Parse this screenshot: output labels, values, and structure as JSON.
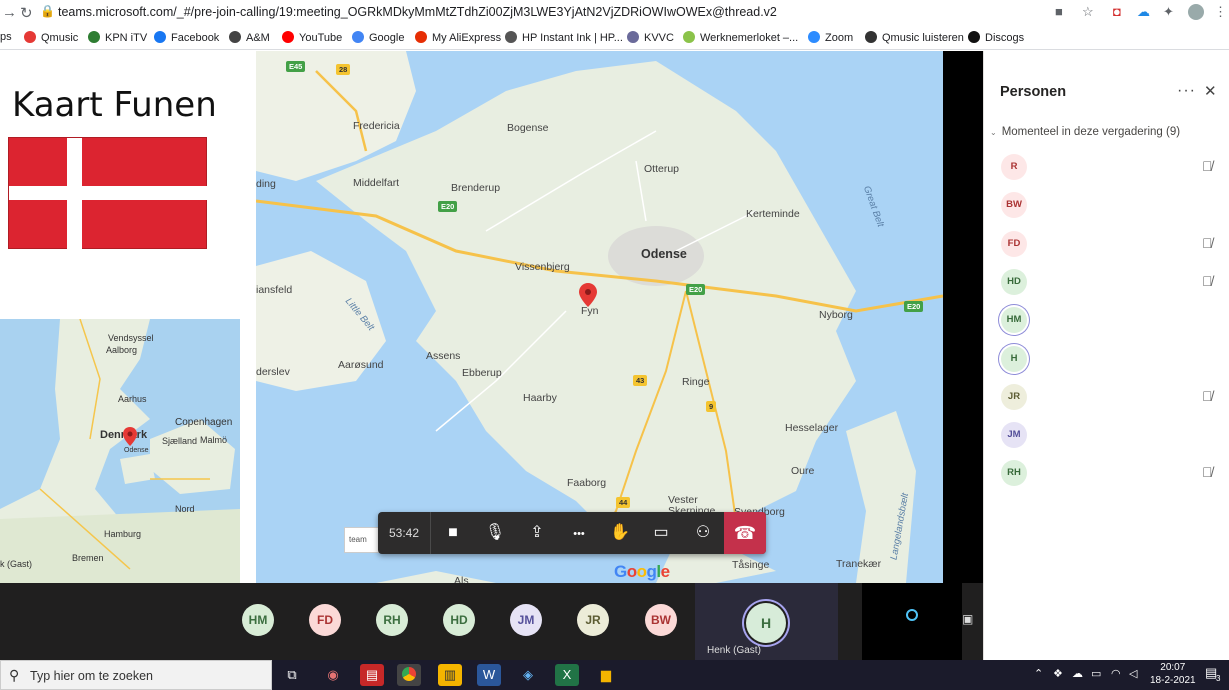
{
  "browser": {
    "url": "teams.microsoft.com/_#/pre-join-calling/19:meeting_OGRkMDkyMmMtZTdhZi00ZjM3LWE3YjAtN2VjZDRiOWIwOWEx@thread.v2",
    "bookmarks": [
      {
        "label": "ps",
        "color": "#9aa0a6"
      },
      {
        "label": "Qmusic",
        "color": "#e53935"
      },
      {
        "label": "KPN iTV",
        "color": "#2e7d32"
      },
      {
        "label": "Facebook",
        "color": "#1877f2"
      },
      {
        "label": "A&M",
        "color": "#444"
      },
      {
        "label": "YouTube",
        "color": "#ff0000"
      },
      {
        "label": "Google",
        "color": "#4285f4"
      },
      {
        "label": "My AliExpress",
        "color": "#e62e04"
      },
      {
        "label": "HP Instant Ink | HP...",
        "color": "#555"
      },
      {
        "label": "KVVC",
        "color": "#6a6a9a"
      },
      {
        "label": "Werknemerloket –...",
        "color": "#8bc34a"
      },
      {
        "label": "Zoom",
        "color": "#2d8cff"
      },
      {
        "label": "Qmusic luisteren",
        "color": "#333"
      },
      {
        "label": "Discogs",
        "color": "#111"
      }
    ]
  },
  "slide": {
    "title": "Kaart Funen",
    "minimap_labels": {
      "vendsyssel": "Vendsyssel",
      "aalborg": "Aalborg",
      "aarhus": "Aarhus",
      "copenhagen": "Copenhagen",
      "denmark": "Denmark",
      "sjaelland": "Sjælland",
      "malmo": "Malmö",
      "odense": "Odense",
      "nord": "Nord",
      "hamburg": "Hamburg",
      "bremen": "Bremen",
      "gast": "k (Gast)"
    }
  },
  "map": {
    "places": {
      "fredericia": "Fredericia",
      "bogense": "Bogense",
      "otterup": "Otterup",
      "middelfart": "Middelfart",
      "brenderup": "Brenderup",
      "kerteminde": "Kerteminde",
      "ding": "ding",
      "odense": "Odense",
      "vissenbjerg": "Vissenbjerg",
      "fyn": "Fyn",
      "iansfeld": "iansfeld",
      "nyborg": "Nyborg",
      "assens": "Assens",
      "aarosund": "Aarøsund",
      "ebberup": "Ebberup",
      "ringe": "Ringe",
      "derslev": "derslev",
      "haarby": "Haarby",
      "hesselager": "Hesselager",
      "oure": "Oure",
      "faaborg": "Faaborg",
      "vester_skerninge": "Vester\nSkerninge",
      "svendborg": "Svendborg",
      "taasinge": "Tåsinge",
      "traneker": "Tranekær",
      "als": "Als"
    },
    "water": {
      "great_belt": "Great Belt",
      "little_belt": "Little Belt",
      "langelandsbaelt": "Langelandsbælt"
    },
    "shields": {
      "e45": "E45",
      "r28": "28",
      "e20a": "E20",
      "e20b": "E20",
      "e20c": "E20",
      "r43": "43",
      "r9": "9",
      "r44": "44"
    },
    "google": "Google",
    "toast": "team"
  },
  "controls": {
    "timer": "53:42",
    "buttons": [
      {
        "name": "camera-icon",
        "glyph": "■"
      },
      {
        "name": "mic-muted-icon",
        "glyph": "🎙"
      },
      {
        "name": "share-screen-icon",
        "glyph": "⇪"
      },
      {
        "name": "more-actions-icon",
        "glyph": "•••"
      },
      {
        "name": "raise-hand-icon",
        "glyph": "✋"
      },
      {
        "name": "chat-icon",
        "glyph": "▭"
      },
      {
        "name": "participants-icon",
        "glyph": "⚇"
      }
    ],
    "hangup_glyph": "☎"
  },
  "panel": {
    "title": "Personen",
    "more": "···",
    "close": "✕",
    "section": "Momenteel in deze vergadering (9)",
    "participants": [
      {
        "initials": "R",
        "bg": "#fde7e7",
        "fg": "#a33",
        "muted": true,
        "ring": false
      },
      {
        "initials": "BW",
        "bg": "#fde7e7",
        "fg": "#a33",
        "muted": false,
        "ring": false
      },
      {
        "initials": "FD",
        "bg": "#fde7e7",
        "fg": "#a33",
        "muted": true,
        "ring": false
      },
      {
        "initials": "HD",
        "bg": "#dcf0dc",
        "fg": "#386a3a",
        "muted": true,
        "ring": false
      },
      {
        "initials": "HM",
        "bg": "#dcf0dc",
        "fg": "#386a3a",
        "muted": false,
        "ring": true
      },
      {
        "initials": "H",
        "bg": "#dcf0dc",
        "fg": "#386a3a",
        "muted": false,
        "ring": true
      },
      {
        "initials": "JR",
        "bg": "#eeeedc",
        "fg": "#5c5c33",
        "muted": true,
        "ring": false
      },
      {
        "initials": "JM",
        "bg": "#e6e3f5",
        "fg": "#55509a",
        "muted": false,
        "ring": false
      },
      {
        "initials": "RH",
        "bg": "#dcf0dc",
        "fg": "#386a3a",
        "muted": true,
        "ring": false
      }
    ]
  },
  "gallery": {
    "avatars": [
      {
        "initials": "HM",
        "bg": "#d8ecd6",
        "fg": "#3b6e3f"
      },
      {
        "initials": "FD",
        "bg": "#fbd9d7",
        "fg": "#a33"
      },
      {
        "initials": "RH",
        "bg": "#d8ecd6",
        "fg": "#3b6e3f"
      },
      {
        "initials": "HD",
        "bg": "#d8ecd6",
        "fg": "#3b6e3f"
      },
      {
        "initials": "JM",
        "bg": "#e6e3f5",
        "fg": "#55509a"
      },
      {
        "initials": "JR",
        "bg": "#ececd8",
        "fg": "#5c5c33"
      },
      {
        "initials": "BW",
        "bg": "#fbd9d7",
        "fg": "#a33"
      }
    ],
    "speaker_initial": "H",
    "speaker_name": "Henk (Gast)"
  },
  "taskbar": {
    "search_placeholder": "Typ hier om te zoeken",
    "time": "20:07",
    "date": "18-2-2021",
    "notification_count": "3"
  }
}
